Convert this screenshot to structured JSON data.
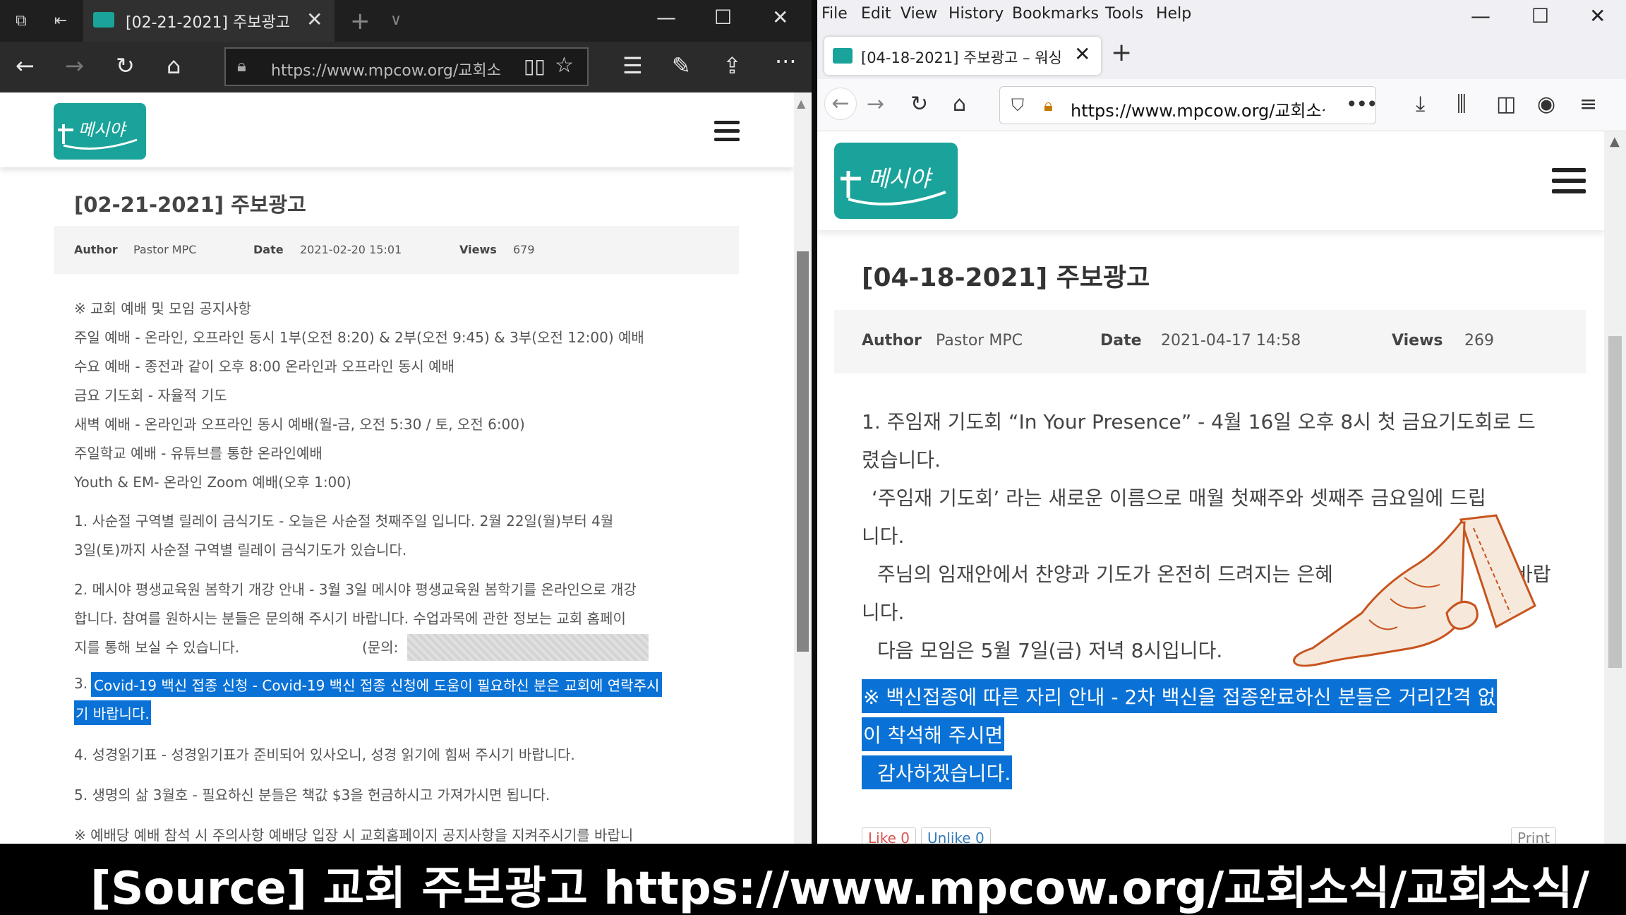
{
  "left_window": {
    "tab_title": "[02-21-2021] 주보광고",
    "url": "https://www.mpcow.org/교회소",
    "url_host": "www.mpcow.org",
    "post": {
      "title": "[02-21-2021] 주보광고",
      "author_label": "Author",
      "author": "Pastor MPC",
      "date_label": "Date",
      "date": "2021-02-20 15:01",
      "views_label": "Views",
      "views": "679",
      "lines": [
        "※ 교회 예배 및 모임 공지사항",
        "주일 예배 - 온라인, 오프라인 동시 1부(오전 8:20) & 2부(오전 9:45) & 3부(오전 12:00) 예배",
        "수요 예배 - 종전과 같이 오후 8:00 온라인과 오프라인 동시 예배",
        "금요 기도회 - 자율적 기도",
        "새벽 예배 - 온라인과 오프라인 동시 예배(월-금, 오전 5:30 / 토, 오전 6:00)",
        "주일학교 예배 - 유튜브를 통한 온라인예배",
        "Youth & EM- 온라인 Zoom 예배(오후 1:00)",
        "1. 사순절 구역별 릴레이 금식기도 - 오늘은 사순절 첫째주일 입니다. 2월 22일(월)부터 4월",
        "3일(토)까지 사순절 구역별 릴레이 금식기도가 있습니다.",
        "2. 메시야 평생교육원 봄학기 개강 안내 - 3월 3일 메시야 평생교육원 봄학기를 온라인으로 개강",
        "합니다. 참여를 원하시는 분들은 문의해 주시기 바랍니다. 수업과목에 관한 정보는 교회 홈페이",
        "지를 통해 보실 수 있습니다.",
        "(문의:",
        "3.",
        "Covid-19 백신 접종 신청 - Covid-19 백신 접종 신청에 도움이 필요하신 분은 교회에 연락주시",
        "기 바랍니다.",
        "4. 성경읽기표 - 성경읽기표가 준비되어 있사오니, 성경 읽기에 힘써 주시기 바랍니다.",
        "5. 생명의 삶 3월호 - 필요하신 분들은 책값 $3을 헌금하시고 가져가시면 됩니다.",
        "※ 예배당 예배 참석 시 주의사항 예배당 입장 시 교회홈페이지 공지사항을 지켜주시기를 바랍니"
      ]
    }
  },
  "right_window": {
    "menu": [
      "File",
      "Edit",
      "View",
      "History",
      "Bookmarks",
      "Tools",
      "Help"
    ],
    "tab_title": "[04-18-2021] 주보광고 – 워싱",
    "url": "https://www.mpcow.org/교회소식/교",
    "post": {
      "title": "[04-18-2021] 주보광고",
      "author_label": "Author",
      "author": "Pastor MPC",
      "date_label": "Date",
      "date": "2021-04-17 14:58",
      "views_label": "Views",
      "views": "269",
      "lines": [
        "1. 주임재 기도회 “In Your Presence” - 4월 16일 오후 8시 첫 금요기도회로 드",
        "렸습니다.",
        "‘주임재 기도회’ 라는 새로운 이름으로 매월 첫째주와 셋째주 금요일에 드립",
        "니다.",
        "주님의 임재안에서 찬양과 기도가 온전히 드려지는 은혜",
        "바랍",
        "니다.",
        "다음 모임은 5월 7일(금) 저녁 8시입니다.",
        "※ 백신접종에 따른 자리 안내 - 2차 백신을 접종완료하신 분들은 거리간격 없",
        "이 착석해 주시면",
        "감사하겠습니다."
      ],
      "like": "Like 0",
      "unlike": "Unlike 0",
      "print": "Print"
    }
  },
  "logo_text": "메시야",
  "caption": "[Source] 교회 주보광고   https://www.mpcow.org/교회소식/교회소식/",
  "colors": {
    "brand": "#1aa39a",
    "highlight": "#0a72d6"
  }
}
